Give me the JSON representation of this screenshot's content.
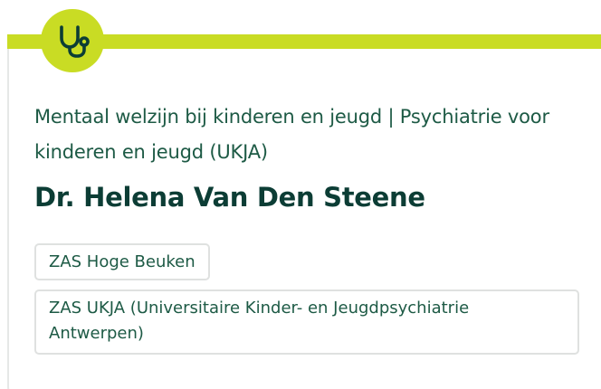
{
  "card": {
    "icon": "stethoscope-icon",
    "accent_color": "#c9dc24",
    "category": "Mentaal welzijn bij kinderen en jeugd | Psychiatrie voor kinderen en jeugd (UKJA)",
    "name": "Dr. Helena Van Den Steene",
    "locations": [
      "ZAS Hoge Beuken",
      "ZAS UKJA (Universitaire Kinder- en Jeugdpsychiatrie Antwerpen)"
    ]
  }
}
